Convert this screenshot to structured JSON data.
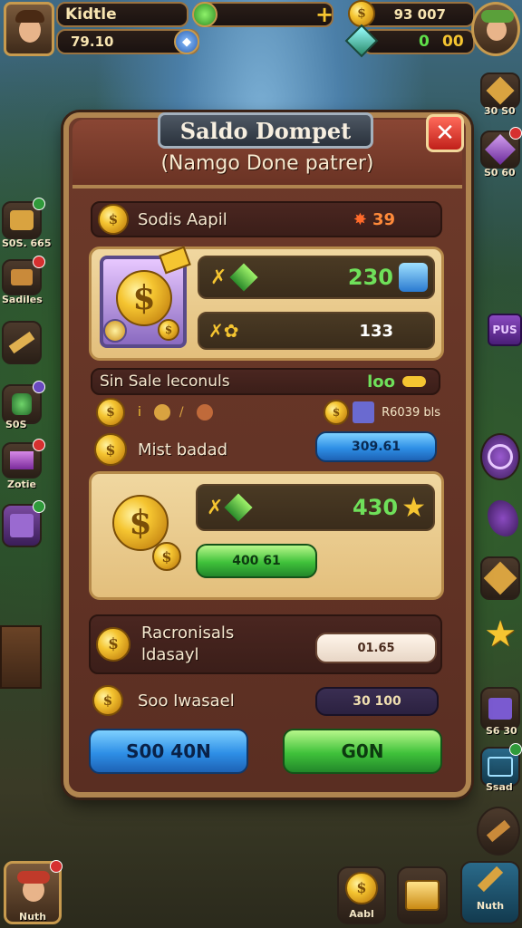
{
  "hud": {
    "player_name": "Kidtle",
    "player_level_value": "79.10",
    "top_mid_value": "",
    "gold_value": "93 007",
    "gem_value": "0",
    "gem_value2": "00"
  },
  "dialog": {
    "title": "Saldo Dompet",
    "subtitle": "(Namgo Done patrer)",
    "row1_label": "Sodis Aapil",
    "row1_value": "39",
    "feature_top_value": "230",
    "feature_bottom_value": "133",
    "section_label": "Sin Sale leconuls",
    "section_value": "loo",
    "small_row_text": "R6039 bls",
    "row2_label": "Mist badad",
    "row2_button": "309.61",
    "feature2_value": "430",
    "feature2_button": "400 61",
    "row3_label_line1": "Racronisals",
    "row3_label_line2": "ldasayl",
    "row3_button": "01.65",
    "row4_label": "Soo Iwasael",
    "row4_value": "30 100",
    "button_left": "S00 40N",
    "button_right": "G0N"
  },
  "left_sidebar": [
    {
      "label": "S0S. 665"
    },
    {
      "label": "Sadiles"
    },
    {
      "label": ""
    },
    {
      "label": "S0S"
    },
    {
      "label": "Zotie"
    },
    {
      "label": ""
    }
  ],
  "right_sidebar": [
    {
      "label": "30 S0"
    },
    {
      "label": "S0 60"
    },
    {
      "label": "PUS"
    },
    {
      "label": ""
    },
    {
      "label": ""
    },
    {
      "label": "S6 30"
    },
    {
      "label": "Ssad"
    }
  ],
  "bottom_bar": {
    "left_label": "Nuth",
    "mid_label": "Aabl",
    "right_label": "Nuth"
  },
  "colors": {
    "accent_gold": "#f5c531",
    "frame": "#b08550",
    "panel": "#6e3a2a"
  }
}
